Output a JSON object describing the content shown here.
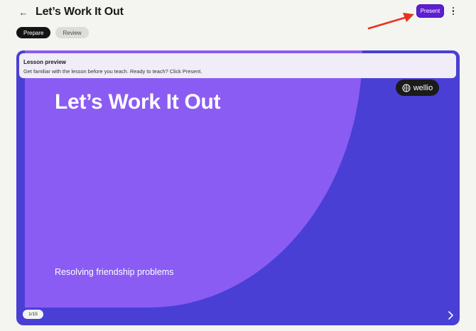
{
  "header": {
    "back_icon": "arrow-left-icon",
    "title": "Let’s Work It Out",
    "present_label": "Present",
    "more_icon": "kebab-vertical-icon"
  },
  "annotation": {
    "arrow_color": "#e8321e"
  },
  "tabs": [
    {
      "label": "Prepare",
      "active": true
    },
    {
      "label": "Review",
      "active": false
    }
  ],
  "banner": {
    "title": "Lesson preview",
    "text": "Get familiar with the lesson before you teach. Ready to teach? Click Present."
  },
  "slide": {
    "title": "Let’s Work It Out",
    "subtitle": "Resolving friendship problems",
    "logo_text": "wellio",
    "page_counter": "1/15",
    "next_icon": "chevron-right-icon"
  },
  "colors": {
    "accent": "#5d1fd0",
    "stage_bg": "#4a3fd4",
    "slide_panel": "#8a5cf3",
    "page_bg": "#f4f4f1"
  }
}
